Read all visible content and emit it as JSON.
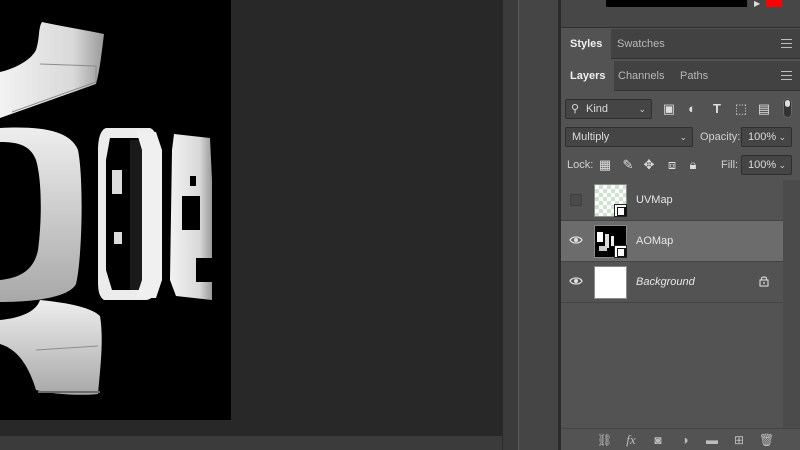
{
  "panels": {
    "top_tabs": [
      {
        "label": "Styles",
        "active": true
      },
      {
        "label": "Swatches",
        "active": false
      }
    ],
    "layer_tabs": [
      {
        "label": "Layers",
        "active": true
      },
      {
        "label": "Channels",
        "active": false
      },
      {
        "label": "Paths",
        "active": false
      }
    ],
    "filter": {
      "kind_label": "Kind"
    },
    "blend": {
      "mode": "Multiply",
      "opacity_label": "Opacity:",
      "opacity_value": "100%"
    },
    "lock": {
      "label": "Lock:",
      "fill_label": "Fill:",
      "fill_value": "100%"
    },
    "layers": [
      {
        "name": "UVMap",
        "visible": false,
        "selected": false,
        "thumbnail": "checker",
        "smart_object": true
      },
      {
        "name": "AOMap",
        "visible": true,
        "selected": true,
        "thumbnail": "ambient-occlusion",
        "smart_object": true
      },
      {
        "name": "Background",
        "visible": true,
        "selected": false,
        "thumbnail": "white",
        "locked": true
      }
    ],
    "footer_icons": [
      "link-icon",
      "fx-icon",
      "mask-icon",
      "adjustment-icon",
      "group-folder-icon",
      "new-layer-icon",
      "trash-icon"
    ]
  },
  "colors": {
    "foreground": "#ff0000",
    "selected_layer": "#6c6c6c",
    "panel_bg": "#535353"
  }
}
